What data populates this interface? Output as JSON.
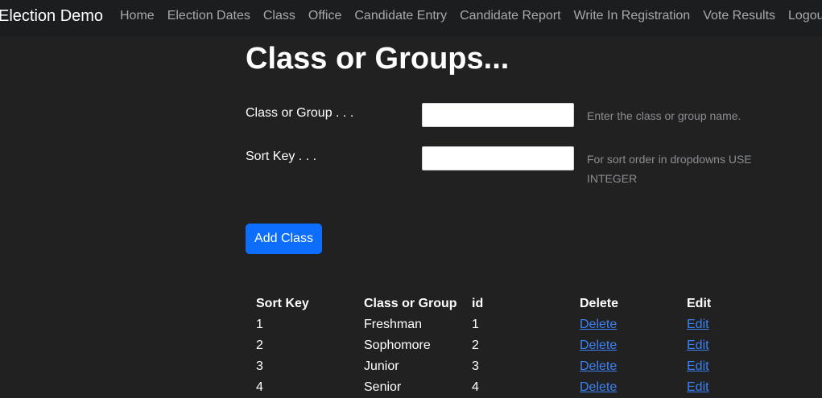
{
  "navbar": {
    "brand": "Election Demo",
    "links": [
      "Home",
      "Election Dates",
      "Class",
      "Office",
      "Candidate Entry",
      "Candidate Report",
      "Write In Registration",
      "Vote Results",
      "Logout"
    ]
  },
  "page": {
    "title": "Class or Groups..."
  },
  "form": {
    "class_label": "Class or Group . . .",
    "class_value": "",
    "class_help": "Enter the class or group name.",
    "sort_label": "Sort Key . . .",
    "sort_value": "",
    "sort_help": "For sort order in dropdowns USE INTEGER",
    "add_button": "Add Class"
  },
  "table": {
    "headers": [
      "Sort Key",
      "Class or Group",
      "id",
      "Delete",
      "Edit"
    ],
    "rows": [
      {
        "sort_key": "1",
        "name": "Freshman",
        "id": "1",
        "delete": "Delete",
        "edit": "Edit"
      },
      {
        "sort_key": "2",
        "name": "Sophomore",
        "id": "2",
        "delete": "Delete",
        "edit": "Edit"
      },
      {
        "sort_key": "3",
        "name": "Junior",
        "id": "3",
        "delete": "Delete",
        "edit": "Edit"
      },
      {
        "sort_key": "4",
        "name": "Senior",
        "id": "4",
        "delete": "Delete",
        "edit": "Edit"
      }
    ]
  },
  "colors": {
    "background": "#212121",
    "navbar": "#1c1d1f",
    "primary": "#0d6efd",
    "link": "#3b82f6"
  }
}
